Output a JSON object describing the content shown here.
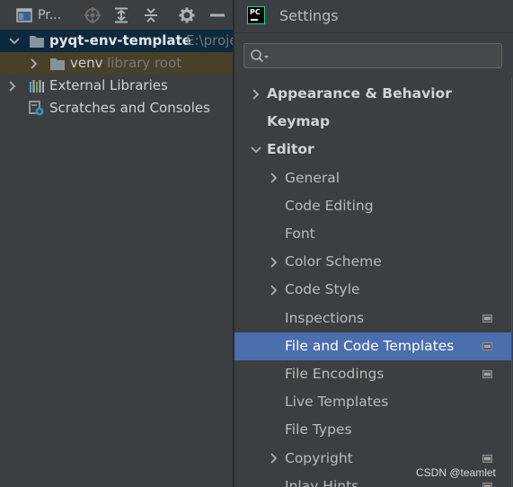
{
  "project_panel": {
    "title": "Pr...",
    "toolbar_icons": [
      "project-view-icon",
      "locate-icon",
      "expand-all-icon",
      "collapse-all-icon",
      "gear-icon",
      "hide-icon"
    ],
    "tree": {
      "root": {
        "name": "pyqt-env-template",
        "path": "E:\\proje"
      },
      "venv": {
        "name": "venv",
        "tag": "library root"
      },
      "external": {
        "label": "External Libraries"
      },
      "scratches": {
        "label": "Scratches and Consoles"
      }
    }
  },
  "settings": {
    "logo_text": "PC",
    "title": "Settings",
    "search": {
      "value": "",
      "placeholder": ""
    },
    "items": [
      {
        "label": "Appearance & Behavior",
        "level": 0,
        "chevron": "right",
        "badge": false
      },
      {
        "label": "Keymap",
        "level": 0,
        "chevron": "none",
        "badge": false
      },
      {
        "label": "Editor",
        "level": 0,
        "chevron": "down",
        "badge": false
      },
      {
        "label": "General",
        "level": 1,
        "chevron": "right",
        "badge": false
      },
      {
        "label": "Code Editing",
        "level": 1,
        "chevron": "none",
        "badge": false
      },
      {
        "label": "Font",
        "level": 1,
        "chevron": "none",
        "badge": false
      },
      {
        "label": "Color Scheme",
        "level": 1,
        "chevron": "right",
        "badge": false
      },
      {
        "label": "Code Style",
        "level": 1,
        "chevron": "right",
        "badge": false
      },
      {
        "label": "Inspections",
        "level": 1,
        "chevron": "none",
        "badge": true
      },
      {
        "label": "File and Code Templates",
        "level": 1,
        "chevron": "none",
        "badge": true,
        "selected": true
      },
      {
        "label": "File Encodings",
        "level": 1,
        "chevron": "none",
        "badge": true
      },
      {
        "label": "Live Templates",
        "level": 1,
        "chevron": "none",
        "badge": false
      },
      {
        "label": "File Types",
        "level": 1,
        "chevron": "none",
        "badge": false
      },
      {
        "label": "Copyright",
        "level": 1,
        "chevron": "right",
        "badge": true
      },
      {
        "label": "Inlay Hints",
        "level": 1,
        "chevron": "none",
        "badge": true
      }
    ]
  },
  "watermark": "CSDN @teamlet",
  "colors": {
    "background": "#2b2b2b",
    "panel": "#3c3f41",
    "selection": "#4b6eaf",
    "root_row": "#0d293e",
    "library_row": "#484029",
    "logo_accent": "#21d789"
  }
}
